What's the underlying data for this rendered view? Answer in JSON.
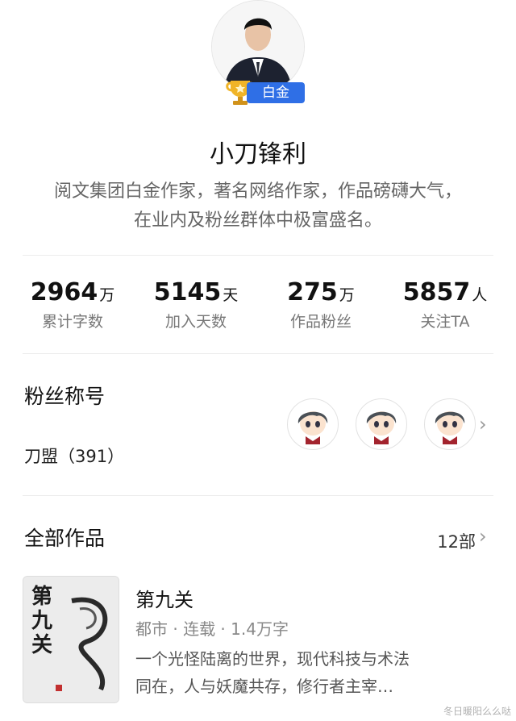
{
  "profile": {
    "rank_label": "白金",
    "name": "小刀锋利",
    "bio_line1": "阅文集团白金作家，著名网络作家，作品磅礴大气，",
    "bio_line2": "在业内及粉丝群体中极富盛名。"
  },
  "stats": [
    {
      "value": "2964",
      "unit": "万",
      "label": "累计字数"
    },
    {
      "value": "5145",
      "unit": "天",
      "label": "加入天数"
    },
    {
      "value": "275",
      "unit": "万",
      "label": "作品粉丝"
    },
    {
      "value": "5857",
      "unit": "人",
      "label": "关注TA"
    }
  ],
  "fans": {
    "title": "粉丝称号",
    "value": "刀盟（391）"
  },
  "works": {
    "title": "全部作品",
    "count": "12部",
    "items": [
      {
        "title": "第九关",
        "meta": "都市 · 连载 · 1.4万字",
        "desc_line1": "一个光怪陆离的世界，现代科技与术法",
        "desc_line2": "同在，人与妖魔共存，修行者主宰…",
        "cover_text": "第九关"
      }
    ]
  },
  "watermark": "冬日暖阳么么哒",
  "colors": {
    "accent": "#2f6fe6",
    "gold": "#e6a21a"
  }
}
